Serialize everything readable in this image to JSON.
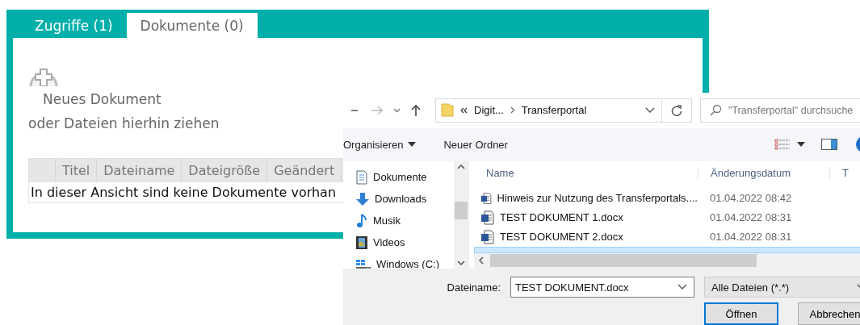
{
  "portal": {
    "tabs": [
      {
        "label": "Zugriffe (1)",
        "selected": false
      },
      {
        "label": "Dokumente (0)",
        "selected": true
      }
    ],
    "new_document": {
      "label": "Neues Dokument"
    },
    "drop_hint": "oder Dateien hierhin ziehen",
    "table": {
      "columns": [
        "Titel",
        "Dateiname",
        "Dateigröße",
        "Geändert"
      ],
      "empty_message": "In dieser Ansicht sind keine Dokumente vorhan"
    }
  },
  "dialog": {
    "address": {
      "parent": "Digit...",
      "current": "Transferportal"
    },
    "search": {
      "placeholder": "\"Transferportal\" durchsuche"
    },
    "toolbar": {
      "organize": "Organisieren",
      "new_folder": "Neuer Ordner"
    },
    "nav_pane": [
      {
        "label": "Dokumente",
        "kind": "documents"
      },
      {
        "label": "Downloads",
        "kind": "downloads"
      },
      {
        "label": "Musik",
        "kind": "music"
      },
      {
        "label": "Videos",
        "kind": "videos"
      },
      {
        "label": "Windows (C:)",
        "kind": "drive"
      }
    ],
    "file_list": {
      "columns": [
        "Name",
        "Änderungsdatum",
        "T"
      ],
      "rows": [
        {
          "name": "Hinweis zur Nutzung des Transferportals....",
          "date": "01.04.2022 08:42",
          "selected": false
        },
        {
          "name": "TEST DOKUMENT 1.docx",
          "date": "01.04.2022 08:31",
          "selected": false
        },
        {
          "name": "TEST DOKUMENT 2.docx",
          "date": "01.04.2022 08:31",
          "selected": false
        },
        {
          "selected": true
        }
      ]
    },
    "filename_label": "Dateiname:",
    "filename": "TEST DOKUMENT.docx",
    "filter": "Alle Dateien (*.*)",
    "buttons": [
      {
        "label": "Öffnen",
        "kind": "default"
      },
      {
        "label": "Abbrechen",
        "kind": "normal"
      }
    ]
  }
}
